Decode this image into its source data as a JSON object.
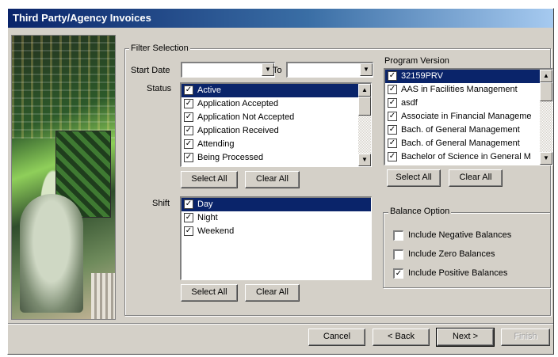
{
  "window": {
    "title": "Third Party/Agency Invoices"
  },
  "filter": {
    "group_label": "Filter Selection",
    "start_date_label": "Start Date",
    "start_date_value": "",
    "to_label": "To",
    "to_value": ""
  },
  "status": {
    "label": "Status",
    "items": [
      {
        "label": "Active",
        "checked": true,
        "selected": true
      },
      {
        "label": "Application Accepted",
        "checked": true,
        "selected": false
      },
      {
        "label": "Application Not Accepted",
        "checked": true,
        "selected": false
      },
      {
        "label": "Application Received",
        "checked": true,
        "selected": false
      },
      {
        "label": "Attending",
        "checked": true,
        "selected": false
      },
      {
        "label": "Being Processed",
        "checked": true,
        "selected": false
      }
    ],
    "select_all": "Select All",
    "clear_all": "Clear All"
  },
  "shift": {
    "label": "Shift",
    "items": [
      {
        "label": "Day",
        "checked": true,
        "selected": true
      },
      {
        "label": "Night",
        "checked": true,
        "selected": false
      },
      {
        "label": "Weekend",
        "checked": true,
        "selected": false
      }
    ],
    "select_all": "Select All",
    "clear_all": "Clear All"
  },
  "program_version": {
    "label": "Program Version",
    "items": [
      {
        "label": "32159PRV",
        "checked": true,
        "selected": true
      },
      {
        "label": "AAS in Facilities Management",
        "checked": true,
        "selected": false
      },
      {
        "label": "asdf",
        "checked": true,
        "selected": false
      },
      {
        "label": "Associate in Financial Manageme",
        "checked": true,
        "selected": false
      },
      {
        "label": "Bach. of General Management",
        "checked": true,
        "selected": false
      },
      {
        "label": "Bach. of General Management",
        "checked": true,
        "selected": false
      },
      {
        "label": "Bachelor of Science in General M",
        "checked": true,
        "selected": false
      }
    ],
    "select_all": "Select All",
    "clear_all": "Clear All"
  },
  "balance": {
    "label": "Balance Option",
    "options": [
      {
        "label": "Include Negative Balances",
        "checked": false
      },
      {
        "label": "Include Zero Balances",
        "checked": false
      },
      {
        "label": "Include Positive Balances",
        "checked": true
      }
    ]
  },
  "footer": {
    "cancel": "Cancel",
    "back": "< Back",
    "next": "Next >",
    "finish": "Finish"
  },
  "icons": {
    "dropdown": "chevron-down-icon",
    "scroll_up": "arrow-up-icon",
    "scroll_down": "arrow-down-icon",
    "checkmark": "checkmark-icon"
  }
}
